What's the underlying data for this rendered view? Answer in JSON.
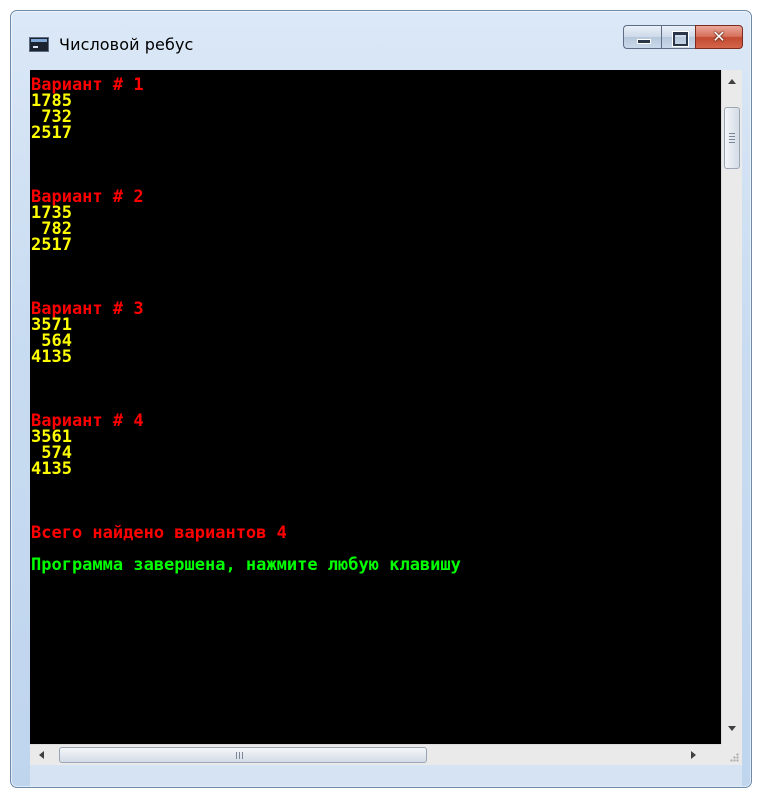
{
  "window": {
    "title": "Числовой ребус",
    "icon": "console-app-icon",
    "close_glyph": "✕"
  },
  "console": {
    "colors": {
      "background": "#000000",
      "heading": "#ff0000",
      "number": "#ffff00",
      "message": "#00ff00"
    },
    "variants": [
      {
        "heading": "Вариант # 1",
        "lines": [
          "1785",
          " 732",
          "2517"
        ]
      },
      {
        "heading": "Вариант # 2",
        "lines": [
          "1735",
          " 782",
          "2517"
        ]
      },
      {
        "heading": "Вариант # 3",
        "lines": [
          "3571",
          " 564",
          "4135"
        ]
      },
      {
        "heading": "Вариант # 4",
        "lines": [
          "3561",
          " 574",
          "4135"
        ]
      }
    ],
    "summary": "Всего найдено вариантов 4",
    "finish": "Программа завершена, нажмите любую клавишу"
  }
}
